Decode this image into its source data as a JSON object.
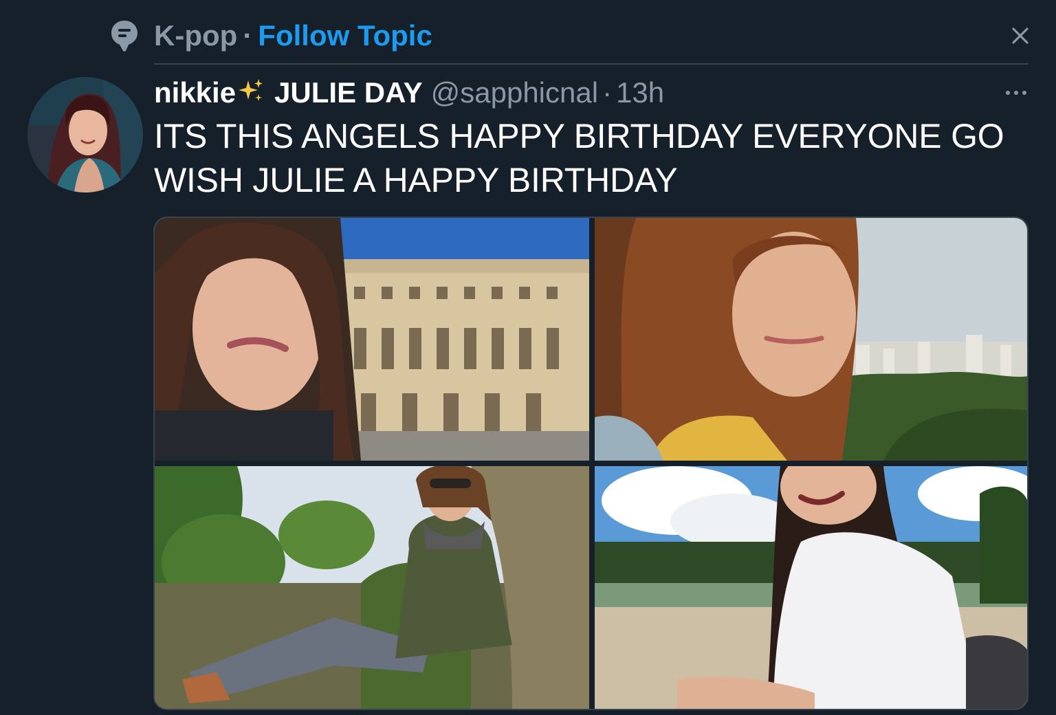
{
  "topic": {
    "name": "K-pop",
    "separator": "·",
    "follow_label": "Follow Topic",
    "icon": "topic-bubble-icon",
    "close_icon": "close-icon"
  },
  "tweet": {
    "display_name_1": "nikkie",
    "emoji": "sparkles-icon",
    "display_name_2": "JULIE DAY",
    "handle": "@sapphicnal",
    "separator": "·",
    "timestamp": "13h",
    "text": "ITS THIS ANGELS HAPPY BIRTHDAY EVERYONE GO WISH JULIE A HAPPY BIRTHDAY",
    "more_icon": "more-icon"
  },
  "media": {
    "photos": [
      {
        "alt": "Selfie in front of a palace"
      },
      {
        "alt": "Selfie with city skyline"
      },
      {
        "alt": "Woman sitting outdoors in green jacket"
      },
      {
        "alt": "Woman laughing in a park"
      }
    ]
  },
  "colors": {
    "background": "#15202b",
    "accent": "#1d9bf0",
    "secondary_text": "#8b98a5",
    "divider": "#38444d"
  }
}
